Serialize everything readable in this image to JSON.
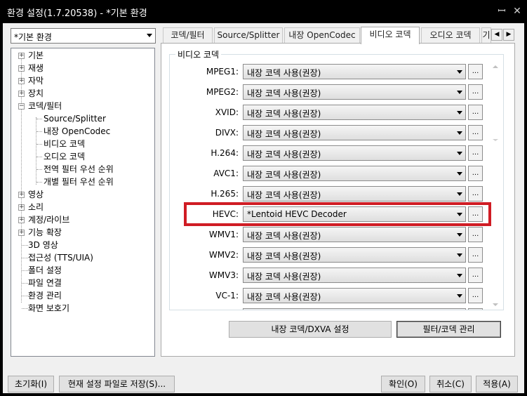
{
  "window": {
    "title": "환경 설정(1.7.20538) - *기본 환경",
    "pin_glyph": "ꟷ",
    "close_glyph": "✕"
  },
  "preset": {
    "value": "*기본 환경"
  },
  "tree": {
    "items": [
      {
        "label": "기본"
      },
      {
        "label": "재생"
      },
      {
        "label": "자막"
      },
      {
        "label": "장치"
      },
      {
        "label": "코덱/필터"
      },
      {
        "label": "Source/Splitter"
      },
      {
        "label": "내장 OpenCodec"
      },
      {
        "label": "비디오 코덱"
      },
      {
        "label": "오디오 코덱"
      },
      {
        "label": "전역 필터 우선 순위"
      },
      {
        "label": "개별 필터 우선 순위"
      },
      {
        "label": "영상"
      },
      {
        "label": "소리"
      },
      {
        "label": "계정/라이브"
      },
      {
        "label": "기능 확장"
      },
      {
        "label": "3D 영상"
      },
      {
        "label": "접근성 (TTS/UIA)"
      },
      {
        "label": "폴더 설정"
      },
      {
        "label": "파일 연결"
      },
      {
        "label": "환경 관리"
      },
      {
        "label": "화면 보호기"
      }
    ]
  },
  "tabs": [
    {
      "label": "코덱/필터"
    },
    {
      "label": "Source/Splitter"
    },
    {
      "label": "내장 OpenCodec"
    },
    {
      "label": "비디오 코덱"
    },
    {
      "label": "오디오 코덱"
    },
    {
      "label": "기"
    }
  ],
  "tab_scroll": {
    "left": "◀",
    "right": "▶"
  },
  "group": {
    "title": "비디오 코덱"
  },
  "codecs": [
    {
      "label": "MPEG1:",
      "value": "내장 코덱 사용(권장)"
    },
    {
      "label": "MPEG2:",
      "value": "내장 코덱 사용(권장)"
    },
    {
      "label": "XVID:",
      "value": "내장 코덱 사용(권장)"
    },
    {
      "label": "DIVX:",
      "value": "내장 코덱 사용(권장)"
    },
    {
      "label": "H.264:",
      "value": "내장 코덱 사용(권장)"
    },
    {
      "label": "AVC1:",
      "value": "내장 코덱 사용(권장)"
    },
    {
      "label": "H.265:",
      "value": "내장 코덱 사용(권장)"
    },
    {
      "label": "HEVC:",
      "value": "*Lentoid HEVC Decoder"
    },
    {
      "label": "WMV1:",
      "value": "내장 코덱 사용(권장)"
    },
    {
      "label": "WMV2:",
      "value": "내장 코덱 사용(권장)"
    },
    {
      "label": "WMV3:",
      "value": "내장 코덱 사용(권장)"
    },
    {
      "label": "VC-1:",
      "value": "내장 코덱 사용(권장)"
    },
    {
      "label": "",
      "value": ""
    }
  ],
  "dots_label": "...",
  "panel_buttons": {
    "dxva": "내장 코덱/DXVA 설정",
    "filter_manage": "필터/코덱 관리"
  },
  "footer": {
    "reset": "초기화(I)",
    "save_file": "현재 설정 파일로 저장(S)...",
    "ok": "확인(O)",
    "cancel": "취소(C)",
    "apply": "적용(A)"
  },
  "colors": {
    "highlight": "#d01c24",
    "titlebar": "#000000"
  }
}
